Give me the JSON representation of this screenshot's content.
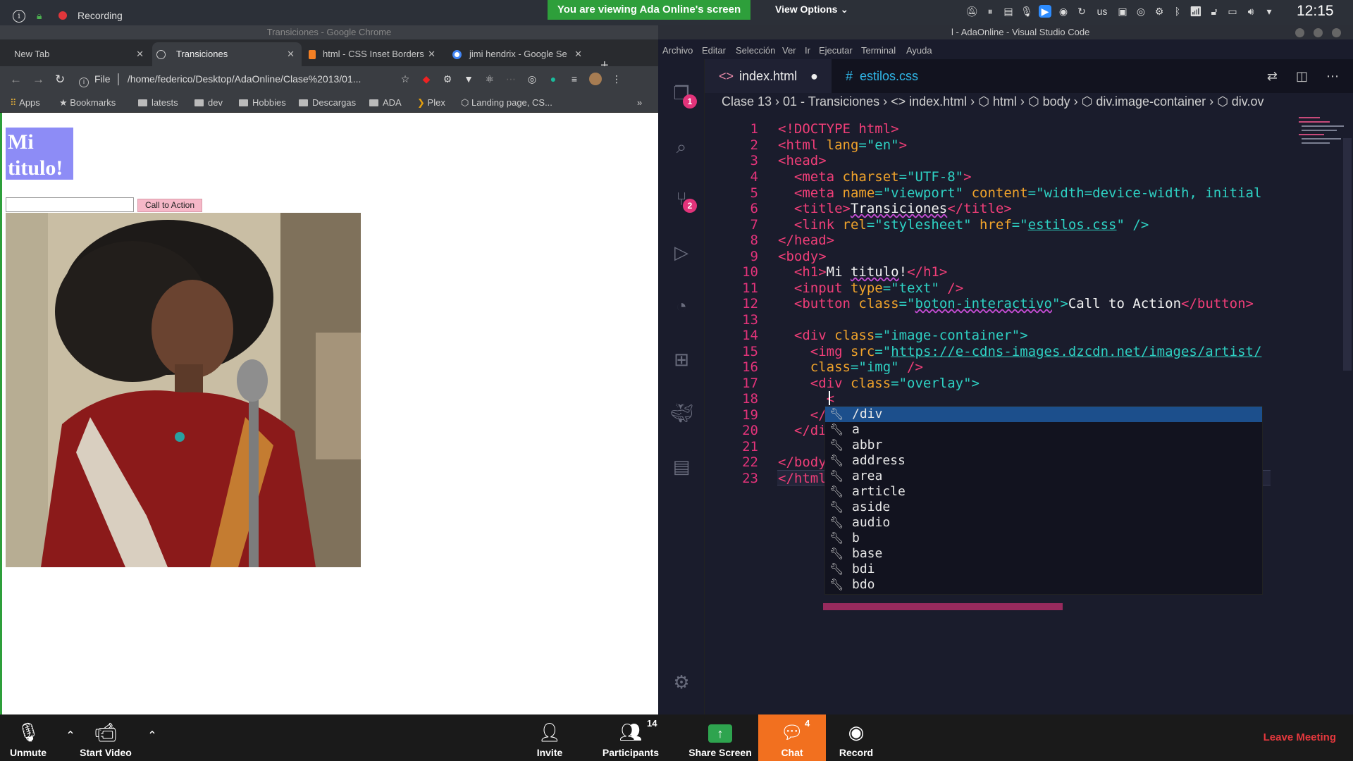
{
  "system_bar": {
    "recording": "Recording",
    "viewing_banner": "You are viewing Ada Online's screen",
    "view_options": "View Options",
    "lang": "us",
    "clock": "12:15"
  },
  "chrome": {
    "window_title": "Transiciones - Google Chrome",
    "tabs": [
      {
        "label": "New Tab"
      },
      {
        "label": "Transiciones"
      },
      {
        "label": "html - CSS Inset Borders"
      },
      {
        "label": "jimi hendrix - Google Se"
      }
    ],
    "url": "/home/federico/Desktop/AdaOnline/Clase%2013/01...",
    "file_label": "File",
    "bookmarks": [
      "Apps",
      "Bookmarks",
      "latests",
      "dev",
      "Hobbies",
      "Descargas",
      "ADA",
      "Plex",
      "Landing page, CS..."
    ],
    "page": {
      "h1": "Mi titulo!",
      "button": "Call to Action",
      "input_value": ""
    }
  },
  "vscode": {
    "window_title": "l - AdaOnline - Visual Studio Code",
    "menu": [
      "Archivo",
      "Editar",
      "Selección",
      "Ver",
      "Ir",
      "Ejecutar",
      "Terminal",
      "Ayuda"
    ],
    "tabs": [
      {
        "label": "index.html",
        "modified": "●"
      },
      {
        "label": "estilos.css"
      }
    ],
    "breadcrumb": "Clase 13  ›  01 - Transiciones  ›  <> index.html  ›  ⬡ html  ›  ⬡ body  ›  ⬡ div.image-container  ›  ⬡ div.ov",
    "badges": {
      "explorer": "1",
      "scm": "2"
    },
    "line_numbers": [
      "1",
      "2",
      "3",
      "4",
      "5",
      "6",
      "7",
      "8",
      "9",
      "10",
      "11",
      "12",
      "13",
      "14",
      "15",
      "16",
      "17",
      "18",
      "19",
      "20",
      "21",
      "22",
      "23"
    ],
    "code": {
      "l1": "<!DOCTYPE html>",
      "l2a": "<html ",
      "l2b": "lang",
      "l2c": "=\"en\"",
      "l2d": ">",
      "l3": "<head>",
      "l4a": "<meta ",
      "l4b": "charset",
      "l4c": "=\"UTF-8\"",
      "l4d": ">",
      "l5a": "<meta ",
      "l5b": "name",
      "l5c": "=\"viewport\" ",
      "l5d": "content",
      "l5e": "=\"width=device-width, initial",
      "l6a": "<title>",
      "l6b": "Transiciones",
      "l6c": "</title>",
      "l7a": "<link ",
      "l7b": "rel",
      "l7c": "=\"stylesheet\" ",
      "l7d": "href",
      "l7e": "=\"",
      "l7f": "estilos.css",
      "l7g": "\" />",
      "l8": "</head>",
      "l9": "<body>",
      "l10a": "<h1>",
      "l10b": "Mi ",
      "l10c": "titulo",
      "l10d": "!",
      "l10e": "</h1>",
      "l11a": "<input ",
      "l11b": "type",
      "l11c": "=\"text\" ",
      "l11d": "/>",
      "l12a": "<button ",
      "l12b": "class",
      "l12c": "=\"",
      "l12d": "boton-interactivo",
      "l12e": "\">",
      "l12f": "Call to Action",
      "l12g": "</button>",
      "l14a": "<div ",
      "l14b": "class",
      "l14c": "=\"image-container\">",
      "l15a": "<img ",
      "l15b": "src",
      "l15c": "=\"",
      "l15d": "https://e-cdns-images.dzcdn.net/images/artist/",
      "l16a": "class",
      "l16b": "=\"img\" ",
      "l16c": "/>",
      "l17a": "<div ",
      "l17b": "class",
      "l17c": "=\"overlay\">",
      "l18": "<",
      "l19": "</d",
      "l20": "</div",
      "l22": "</body>",
      "l23": "</html>"
    },
    "suggestions": [
      "/div",
      "a",
      "abbr",
      "address",
      "area",
      "article",
      "aside",
      "audio",
      "b",
      "base",
      "bdi",
      "bdo"
    ]
  },
  "zoom": {
    "unmute": "Unmute",
    "start_video": "Start Video",
    "invite": "Invite",
    "participants": "Participants",
    "participants_count": "14",
    "share_screen": "Share Screen",
    "chat": "Chat",
    "chat_count": "4",
    "record": "Record",
    "leave": "Leave Meeting"
  },
  "colors": {
    "zoom_chat": "#f2701f",
    "banner_green": "#2e9f3b",
    "h1_bg": "#8d8cf6",
    "cta_bg": "#f6b8c8",
    "vscode_tag": "#f03e78",
    "vscode_attr": "#f0a32b",
    "vscode_string": "#2ed2c4",
    "suggestion_selected": "#1c4f8c"
  }
}
